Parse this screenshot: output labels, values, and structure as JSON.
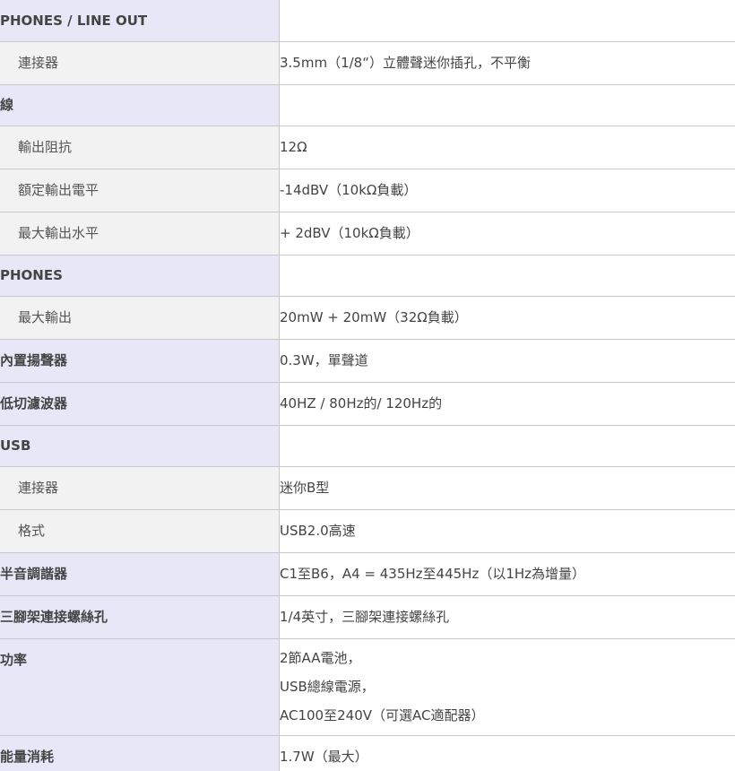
{
  "rows": [
    {
      "label": "PHONES / LINE OUT",
      "value": ""
    },
    {
      "label": "連接器",
      "value": "3.5mm（1/8“）立體聲迷你插孔，不平衡"
    },
    {
      "label": "線",
      "value": ""
    },
    {
      "label": "輸出阻抗",
      "value": "12Ω"
    },
    {
      "label": "額定輸出電平",
      "value": "-14dBV（10kΩ負載）"
    },
    {
      "label": "最大輸出水平",
      "value": "+ 2dBV（10kΩ負載）"
    },
    {
      "label": "PHONES",
      "value": ""
    },
    {
      "label": "最大輸出",
      "value": "20mW + 20mW（32Ω負載）"
    },
    {
      "label": "內置揚聲器",
      "value": "0.3W，單聲道"
    },
    {
      "label": "低切濾波器",
      "value": "40HZ / 80Hz的/ 120Hz的"
    },
    {
      "label": "USB",
      "value": ""
    },
    {
      "label": "連接器",
      "value": "迷你B型"
    },
    {
      "label": "格式",
      "value": "USB2.0高速"
    },
    {
      "label": "半音調諧器",
      "value": "C1至B6，A4 = 435Hz至445Hz（以1Hz為增量）"
    },
    {
      "label": "三腳架連接螺絲孔",
      "value": "1/4英寸，三腳架連接螺絲孔"
    },
    {
      "label": "功率",
      "value_lines": [
        "2節AA電池，",
        "USB總線電源，",
        "AC100至240V（可選AC適配器）"
      ]
    },
    {
      "label": "能量消耗",
      "value": "1.7W（最大）"
    }
  ]
}
